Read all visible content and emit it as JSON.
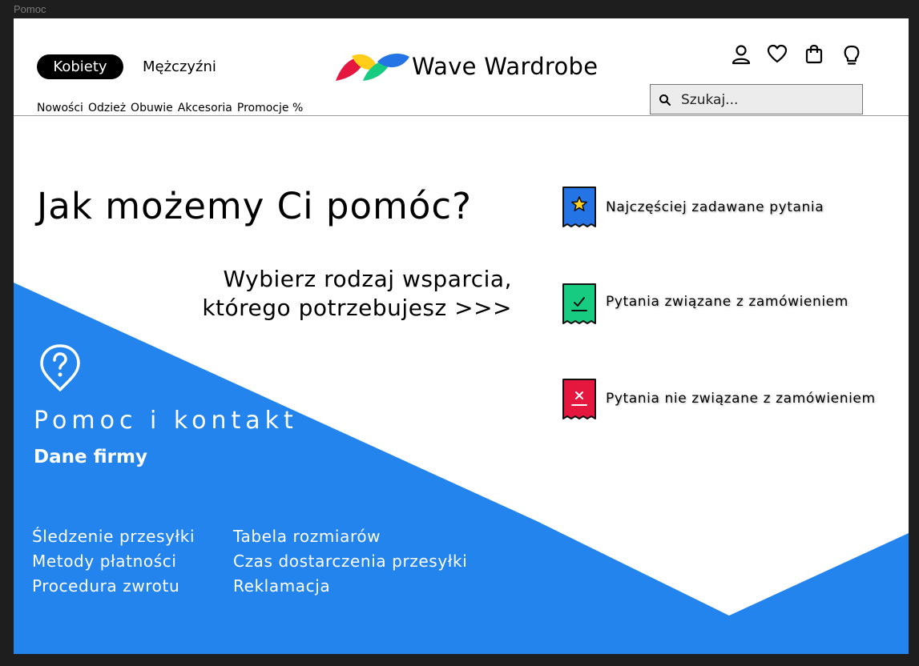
{
  "frame_label": "Pomoc",
  "colors": {
    "accent_blue": "#2384ee",
    "faq_icon": "#2474e6",
    "order_icon": "#17cc80",
    "non_order_icon": "#e5173f",
    "star": "#ffd21f"
  },
  "header": {
    "gender_tabs": [
      "Kobiety",
      "Mężczyźni"
    ],
    "nav": [
      "Nowości",
      "Odzież",
      "Obuwie",
      "Akcesoria",
      "Promocje %"
    ],
    "brand": "Wave Wardrobe",
    "icons": [
      "user-icon",
      "heart-icon",
      "bag-icon",
      "lightbulb-icon"
    ],
    "search": {
      "placeholder": "Szukaj..."
    }
  },
  "hero": {
    "title": "Jak możemy Ci pomóc?",
    "subtitle_line1": "Wybierz rodzaj wsparcia,",
    "subtitle_line2": "którego potrzebujesz >>>"
  },
  "support_options": [
    {
      "label": "Najczęściej zadawane pytania",
      "icon": "star-ribbon-icon"
    },
    {
      "label": "Pytania związane z zamówieniem",
      "icon": "check-ribbon-icon"
    },
    {
      "label": "Pytania nie związane z zamówieniem",
      "icon": "x-ribbon-icon"
    }
  ],
  "help": {
    "icon": "question-pin-icon",
    "title": "Pomoc i kontakt",
    "company_link": "Dane firmy",
    "links_col1": [
      "Śledzenie przesyłki",
      "Metody płatności",
      "Procedura zwrotu"
    ],
    "links_col2": [
      "Tabela rozmiarów",
      "Czas dostarczenia przesyłki",
      "Reklamacja"
    ]
  }
}
